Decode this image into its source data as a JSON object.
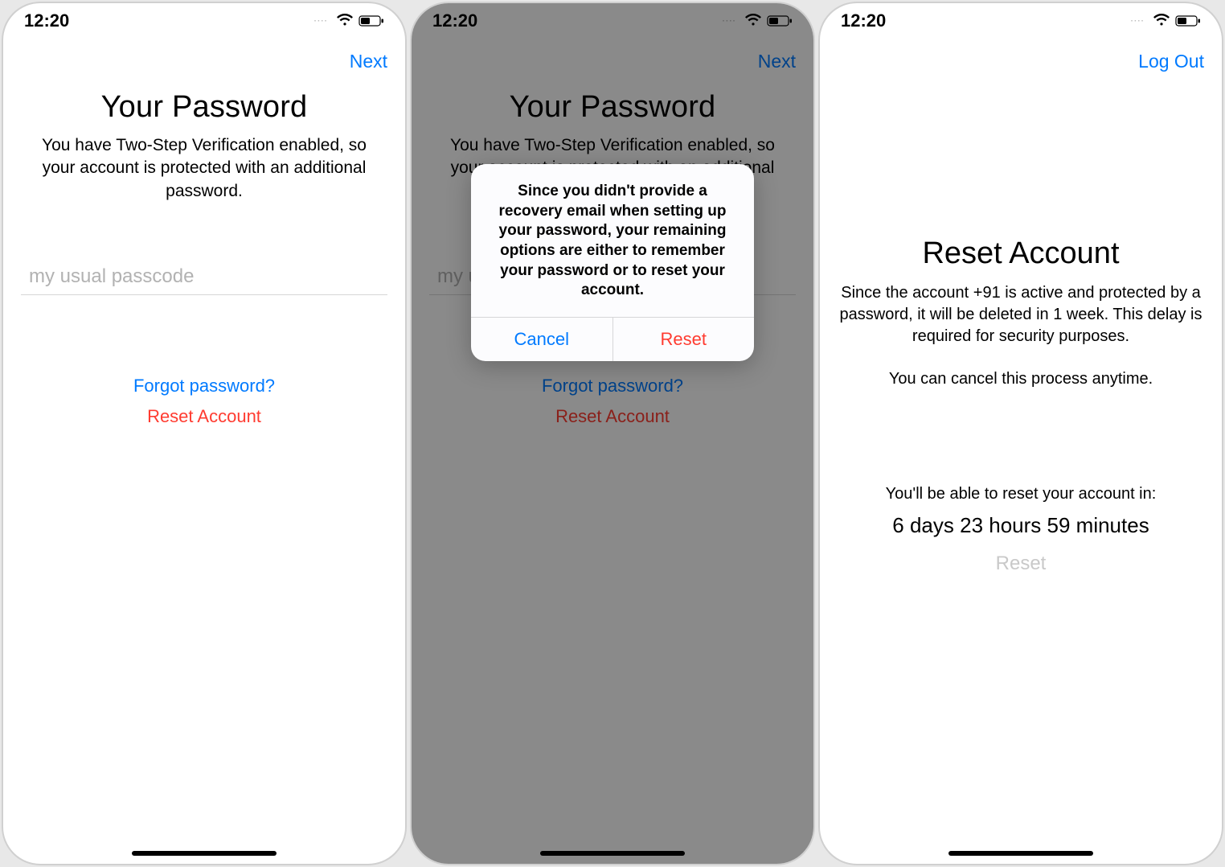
{
  "status": {
    "time": "12:20",
    "dots": "····"
  },
  "screen1": {
    "nav_right": "Next",
    "title": "Your Password",
    "desc": "You have Two-Step Verification enabled, so your account is protected with an additional password.",
    "input_placeholder": "my usual passcode",
    "input_value": "",
    "forgot": "Forgot password?",
    "reset": "Reset Account"
  },
  "screen2": {
    "nav_right": "Next",
    "title": "Your Password",
    "desc": "You have Two-Step Verification enabled, so your account is protected with an additional password.",
    "forgot": "Forgot password?",
    "reset": "Reset Account",
    "alert": {
      "message": "Since you didn't provide a recovery email when setting up your password, your remaining options are either to remember your password or to reset your account.",
      "cancel": "Cancel",
      "reset": "Reset"
    }
  },
  "screen3": {
    "nav_right": "Log Out",
    "title": "Reset Account",
    "desc": "Since the account +91                     is active and protected by a password, it will be deleted in 1 week. This delay is required for security purposes.",
    "cancel_msg": "You can cancel this process anytime.",
    "countdown_label": "You'll be able to reset your account in:",
    "countdown_value": "6 days 23 hours 59 minutes",
    "reset": "Reset"
  }
}
